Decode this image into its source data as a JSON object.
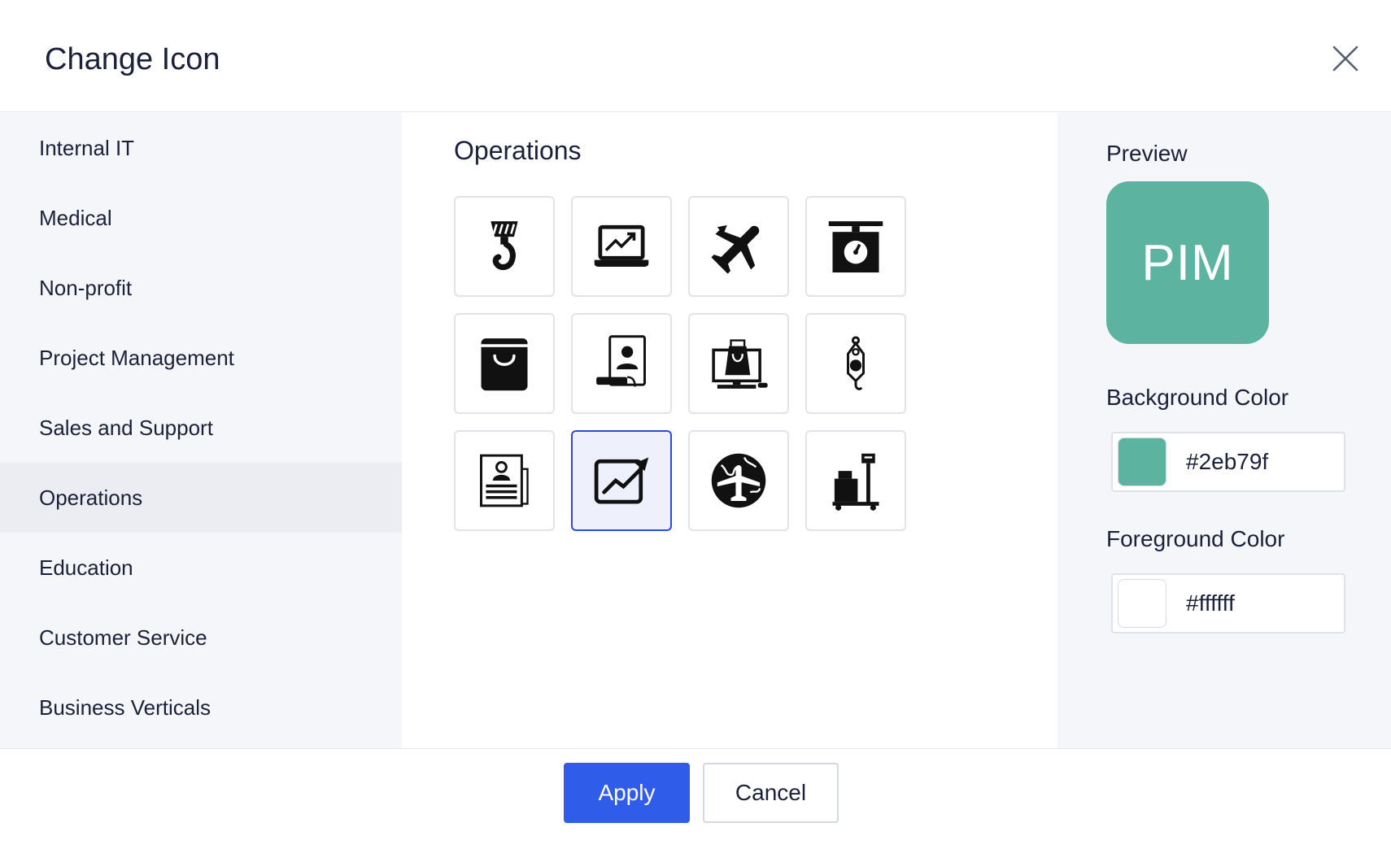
{
  "dialog": {
    "title": "Change Icon",
    "close_icon": "close-icon"
  },
  "sidebar": {
    "items": [
      {
        "label": "Internal IT",
        "active": false
      },
      {
        "label": "Medical",
        "active": false
      },
      {
        "label": "Non-profit",
        "active": false
      },
      {
        "label": "Project Management",
        "active": false
      },
      {
        "label": "Sales and Support",
        "active": false
      },
      {
        "label": "Operations",
        "active": true
      },
      {
        "label": "Education",
        "active": false
      },
      {
        "label": "Customer Service",
        "active": false
      },
      {
        "label": "Business Verticals",
        "active": false
      }
    ]
  },
  "main": {
    "section_title": "Operations",
    "icons": [
      {
        "name": "crane-hook-icon",
        "selected": false
      },
      {
        "name": "laptop-analytics-icon",
        "selected": false
      },
      {
        "name": "airplane-tools-icon",
        "selected": false
      },
      {
        "name": "weighing-scale-icon",
        "selected": false
      },
      {
        "name": "shopping-bag-icon",
        "selected": false
      },
      {
        "name": "id-badge-icon",
        "selected": false
      },
      {
        "name": "online-shopping-icon",
        "selected": false
      },
      {
        "name": "hanging-scale-icon",
        "selected": false
      },
      {
        "name": "profile-document-icon",
        "selected": false
      },
      {
        "name": "growth-chart-icon",
        "selected": true
      },
      {
        "name": "global-travel-icon",
        "selected": false
      },
      {
        "name": "hand-truck-icon",
        "selected": false
      }
    ]
  },
  "preview": {
    "label": "Preview",
    "text": "PIM",
    "background_label": "Background Color",
    "background_value": "#2eb79f",
    "foreground_label": "Foreground Color",
    "foreground_value": "#ffffff",
    "background_display": "#5bb3a0",
    "foreground_display": "#ffffff"
  },
  "footer": {
    "apply_label": "Apply",
    "cancel_label": "Cancel"
  },
  "colors": {
    "accent": "#2f5ce9",
    "selected_border": "#2e4bd6"
  }
}
